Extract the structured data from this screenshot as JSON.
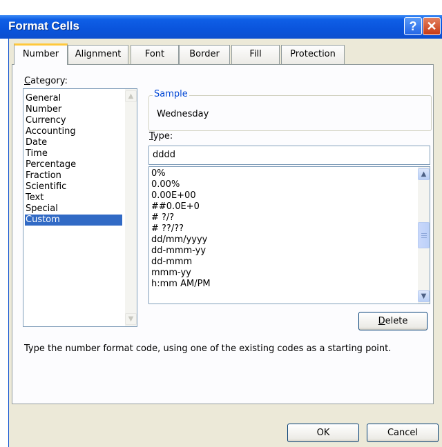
{
  "window": {
    "title": "Format Cells",
    "help_glyph": "?",
    "close_glyph": "✕"
  },
  "tabs": [
    {
      "label": "Number",
      "active": true
    },
    {
      "label": "Alignment"
    },
    {
      "label": "Font"
    },
    {
      "label": "Border"
    },
    {
      "label": "Fill"
    },
    {
      "label": "Protection"
    }
  ],
  "category": {
    "label_underlined": "C",
    "label_rest": "ategory:",
    "items": [
      "General",
      "Number",
      "Currency",
      "Accounting",
      "Date",
      "Time",
      "Percentage",
      "Fraction",
      "Scientific",
      "Text",
      "Special",
      "Custom"
    ],
    "selected": "Custom"
  },
  "sample": {
    "group_label": "Sample",
    "value": "Wednesday"
  },
  "type": {
    "label_underlined": "T",
    "label_rest": "ype:",
    "value": "dddd",
    "codes": [
      "0%",
      "0.00%",
      "0.00E+00",
      "##0.0E+0",
      "# ?/?",
      "# ??/??",
      "dd/mm/yyyy",
      "dd-mmm-yy",
      "dd-mmm",
      "mmm-yy",
      "h:mm AM/PM"
    ]
  },
  "buttons": {
    "delete_underlined": "D",
    "delete_rest": "elete",
    "ok": "OK",
    "cancel": "Cancel"
  },
  "hint": "Type the number format code, using one of the existing codes as a starting point.",
  "icons": {
    "scroll_up": "up-arrow-icon",
    "scroll_down": "down-arrow-icon"
  },
  "colors": {
    "title_bar": "#0a54dc",
    "dialog_bg": "#ece9d8",
    "selection": "#316ac5",
    "active_tab_highlight": "#ffc83c"
  }
}
